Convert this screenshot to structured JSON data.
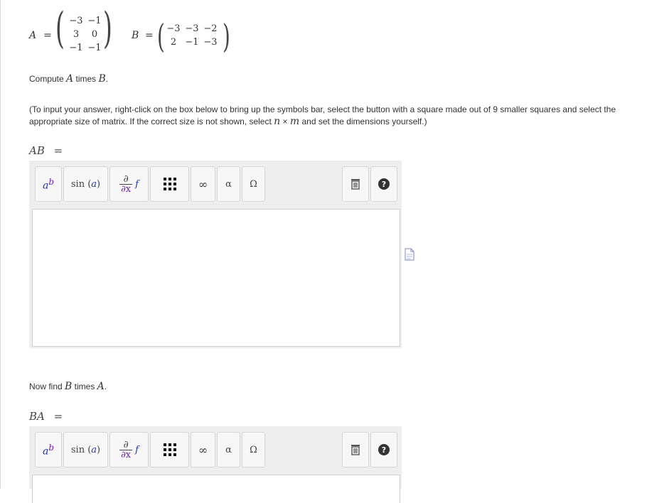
{
  "matrix_a": {
    "name": "A",
    "rows": [
      [
        "−3",
        "−1"
      ],
      [
        "3",
        "0"
      ],
      [
        "−1",
        "−1"
      ]
    ]
  },
  "matrix_b": {
    "name": "B",
    "rows": [
      [
        "−3",
        "−3",
        "−2"
      ],
      [
        "2",
        "−1",
        "−3"
      ]
    ]
  },
  "q1": {
    "prefix": "Compute ",
    "var1": "A",
    "mid": " times ",
    "var2": "B",
    "suffix": "."
  },
  "instructions": {
    "line1": "(To input your answer, right-click on the box below to bring up the symbols bar, select the button with a square made out of 9 smaller squares and select the",
    "line2_pre": "appropriate size of matrix. If the correct size is not shown, select ",
    "n": "n",
    "times": "×",
    "m": "m",
    "line2_post": " and set the dimensions yourself.)"
  },
  "answer1": {
    "label": "AB",
    "eq": "=",
    "value": ""
  },
  "q2": {
    "prefix": "Now find ",
    "var1": "B",
    "mid": " times ",
    "var2": "A",
    "suffix": "."
  },
  "answer2": {
    "label": "BA",
    "eq": "=",
    "value": ""
  },
  "toolbar": {
    "superscript": {
      "base": "a",
      "exp": "b",
      "icon": "superscript-icon"
    },
    "trig": {
      "fn": "sin",
      "lp": "(",
      "arg": "a",
      "rp": ")"
    },
    "derivative": {
      "num": "∂",
      "den": "∂x",
      "f": "f",
      "icon": "derivative-icon"
    },
    "matrix_icon": "matrix-grid-icon",
    "infinity": "∞",
    "alpha": "α",
    "omega": "Ω",
    "trash_icon": "trash-icon",
    "help_icon": "help-icon"
  },
  "colors": {
    "toolbar_bg": "#eeeeee",
    "button_bg": "#f7f7f7",
    "symbol_blue": "#1a33c8",
    "symbol_purple": "#7a1ab8",
    "help_bg": "#333333"
  }
}
